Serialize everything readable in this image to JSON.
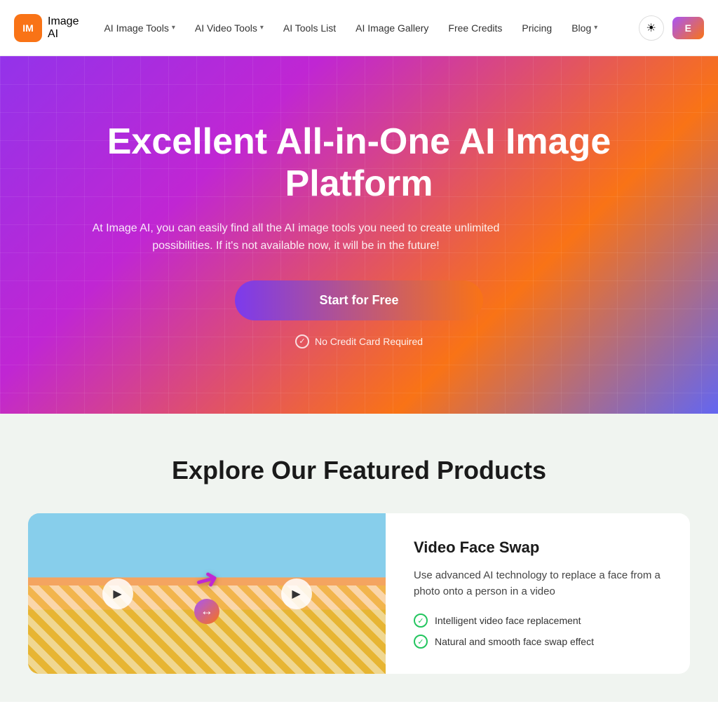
{
  "logo": {
    "icon_text": "IM",
    "text_top": "Image",
    "text_bottom": "AI"
  },
  "nav": {
    "items": [
      {
        "label": "AI Image Tools",
        "has_dropdown": true
      },
      {
        "label": "AI Video Tools",
        "has_dropdown": true
      },
      {
        "label": "AI Tools List",
        "has_dropdown": false
      },
      {
        "label": "AI Image Gallery",
        "has_dropdown": false
      },
      {
        "label": "Free Credits",
        "has_dropdown": false
      },
      {
        "label": "Pricing",
        "has_dropdown": false
      },
      {
        "label": "Blog",
        "has_dropdown": true
      }
    ],
    "theme_icon": "☀",
    "signin_label": "E"
  },
  "hero": {
    "title": "Excellent All-in-One AI Image Platform",
    "subtitle": "At Image AI, you can easily find all the AI image tools you need to create unlimited possibilities. If it's not available now, it will be in the future!",
    "cta_label": "Start for Free",
    "no_credit_label": "No Credit Card Required"
  },
  "featured": {
    "section_title": "Explore Our Featured Products",
    "product": {
      "name": "Video Face Swap",
      "description": "Use advanced AI technology to replace a face from a photo onto a person in a video",
      "features": [
        "Intelligent video face replacement",
        "Natural and smooth face swap effect"
      ]
    }
  }
}
